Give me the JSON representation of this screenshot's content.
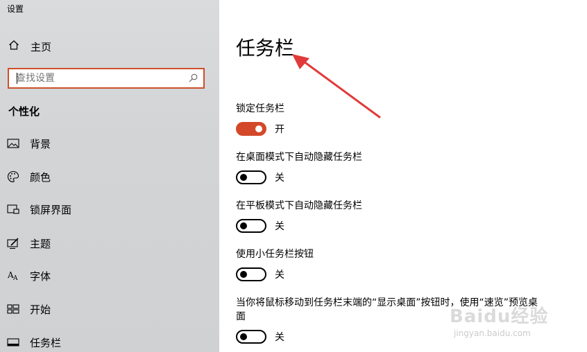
{
  "window": {
    "title": "设置"
  },
  "sidebar": {
    "home_label": "主页",
    "search_placeholder": "查找设置",
    "section_title": "个性化",
    "items": [
      {
        "label": "背景",
        "icon": "picture-icon"
      },
      {
        "label": "颜色",
        "icon": "palette-icon"
      },
      {
        "label": "锁屏界面",
        "icon": "lock-screen-icon"
      },
      {
        "label": "主题",
        "icon": "theme-icon"
      },
      {
        "label": "字体",
        "icon": "font-icon"
      },
      {
        "label": "开始",
        "icon": "start-icon"
      },
      {
        "label": "任务栏",
        "icon": "taskbar-icon"
      }
    ]
  },
  "main": {
    "title": "任务栏",
    "settings": [
      {
        "label": "锁定任务栏",
        "state": "on",
        "state_label": "开"
      },
      {
        "label": "在桌面模式下自动隐藏任务栏",
        "state": "off",
        "state_label": "关"
      },
      {
        "label": "在平板模式下自动隐藏任务栏",
        "state": "off",
        "state_label": "关"
      },
      {
        "label": "使用小任务栏按钮",
        "state": "off",
        "state_label": "关"
      },
      {
        "label": "当你将鼠标移动到任务栏末端的“显示桌面”按钮时，使用“速览”预览桌面",
        "state": "off",
        "state_label": "关"
      }
    ]
  },
  "watermark": {
    "brand": "Baidu经验",
    "url": "jingyan.baidu.com"
  },
  "colors": {
    "accent": "#d4482a",
    "search_border": "#cc4f2a",
    "arrow": "#e23a3a"
  }
}
